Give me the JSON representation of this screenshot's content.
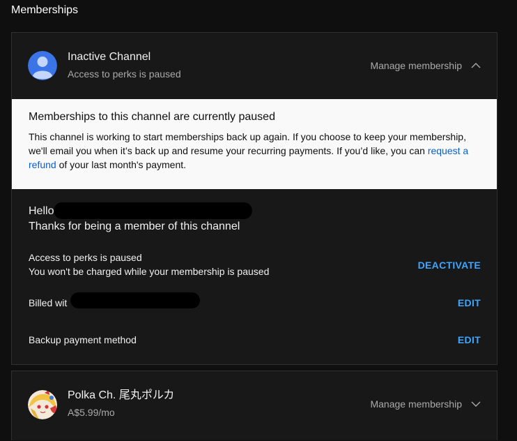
{
  "page": {
    "title": "Memberships"
  },
  "memberships": [
    {
      "channel_name": "Inactive Channel",
      "subtitle": "Access to perks is paused",
      "manage_label": "Manage membership",
      "expanded": true,
      "notice": {
        "title": "Memberships to this channel are currently paused",
        "body_before_link": "This channel is working to start memberships back up again. If you choose to keep your membership, we'll email you when it’s back up and resume your recurring payments. If you’d like, you can ",
        "link_text": "request a refund",
        "body_after_link": " of your last month's payment."
      },
      "greeting": "Hello",
      "thanks": "Thanks for being a member of this channel",
      "perks_status": "Access to perks is paused",
      "charge_note": "You won't be charged while your membership is paused",
      "deactivate_label": "DEACTIVATE",
      "billed_label": "Billed wit",
      "edit_label": "EDIT",
      "backup_label": "Backup payment method",
      "backup_edit_label": "EDIT"
    },
    {
      "channel_name": "Polka Ch. 尾丸ポルカ",
      "subtitle": "A$5.99/mo",
      "manage_label": "Manage membership",
      "expanded": false
    }
  ],
  "colors": {
    "background": "#0f0f0f",
    "card": "#181818",
    "accent": "#3ea6ff",
    "notice_bg": "#f9f9f9"
  },
  "icons": [
    "default-avatar-icon",
    "chevron-up-icon",
    "chevron-down-icon",
    "polka-avatar-icon"
  ]
}
